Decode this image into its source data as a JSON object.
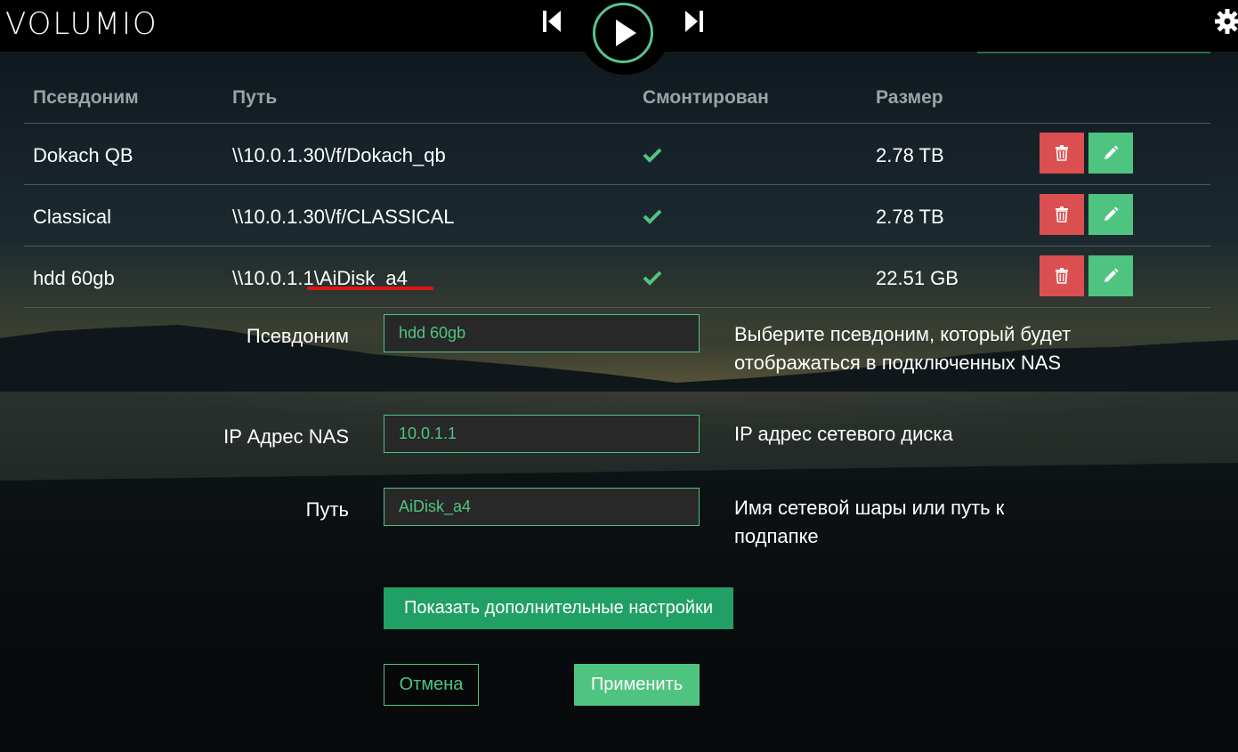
{
  "header": {
    "logo": "VOLUMIO",
    "icons": {
      "prev": "skip-previous-icon",
      "play": "play-icon",
      "next": "skip-next-icon",
      "settings": "gear-icon"
    }
  },
  "colors": {
    "accent": "#4fc481",
    "delete": "#db4f51",
    "advanced_button": "#21a065",
    "red_underline": "#e01414"
  },
  "table": {
    "headers": {
      "alias": "Псевдоним",
      "path": "Путь",
      "mounted": "Смонтирован",
      "size": "Размер"
    },
    "rows": [
      {
        "alias": "Dokach QB",
        "path": "\\\\10.0.1.30\\/f/Dokach_qb",
        "mounted": true,
        "size": "2.78 TB"
      },
      {
        "alias": "Classical",
        "path": "\\\\10.0.1.30\\/f/CLASSICAL",
        "mounted": true,
        "size": "2.78 TB"
      },
      {
        "alias": "hdd 60gb",
        "path": "\\\\10.0.1.1\\AiDisk_a4",
        "mounted": true,
        "size": "22.51 GB"
      }
    ]
  },
  "form": {
    "alias": {
      "label": "Псевдоним",
      "value": "hdd 60gb",
      "help": "Выберите псевдоним, который будет отображаться в подключенных NAS"
    },
    "ip": {
      "label": "IP Адрес NAS",
      "value": "10.0.1.1",
      "help": "IP адрес сетевого диска"
    },
    "path": {
      "label": "Путь",
      "value": "AiDisk_a4",
      "help": "Имя сетевой шары или путь к подпапке"
    },
    "advanced_label": "Показать дополнительные настройки",
    "cancel_label": "Отмена",
    "apply_label": "Применить"
  }
}
